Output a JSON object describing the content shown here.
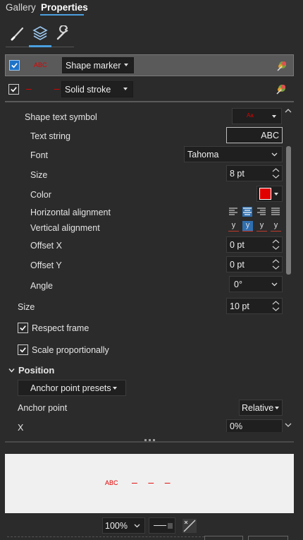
{
  "tabs": [
    {
      "label": "Gallery"
    },
    {
      "label": "Properties"
    }
  ],
  "tools": [
    {
      "icon": "brush-icon"
    },
    {
      "icon": "layers-icon"
    },
    {
      "icon": "wrench-icon"
    }
  ],
  "layers": [
    {
      "name": "Shape marker",
      "preview": "ABC",
      "checked": true
    },
    {
      "name": "Solid stroke",
      "preview": "– –",
      "checked": true
    }
  ],
  "properties": {
    "shape_text_symbol": {
      "label": "Shape text symbol",
      "value": "Aa"
    },
    "text_string": {
      "label": "Text string",
      "value": "ABC"
    },
    "font": {
      "label": "Font",
      "value": "Tahoma"
    },
    "size_inner": {
      "label": "Size",
      "value": "8 pt"
    },
    "color": {
      "label": "Color",
      "value": "#e00000"
    },
    "horizontal_alignment": {
      "label": "Horizontal alignment"
    },
    "vertical_alignment": {
      "label": "Vertical alignment",
      "glyph": "y"
    },
    "offset_x": {
      "label": "Offset X",
      "value": "0 pt"
    },
    "offset_y": {
      "label": "Offset Y",
      "value": "0 pt"
    },
    "angle": {
      "label": "Angle",
      "value": "0°"
    },
    "size": {
      "label": "Size",
      "value": "10 pt"
    },
    "respect_frame": {
      "label": "Respect frame",
      "checked": true
    },
    "scale_proportionally": {
      "label": "Scale proportionally",
      "checked": true
    },
    "position": {
      "label": "Position"
    },
    "anchor_point_presets": {
      "label": "Anchor point presets"
    },
    "anchor_point": {
      "label": "Anchor point",
      "value": "Relative"
    },
    "x": {
      "label": "X",
      "value": "0%"
    }
  },
  "preview": {
    "text": "ABC",
    "dashes": "–    –    –"
  },
  "footer": {
    "zoom": "100%"
  },
  "colors": {
    "accent": "#4a9fe0",
    "marker_red": "#e00000",
    "panel_bg": "#2b2b2b",
    "field_bg": "#1f1f1f"
  }
}
